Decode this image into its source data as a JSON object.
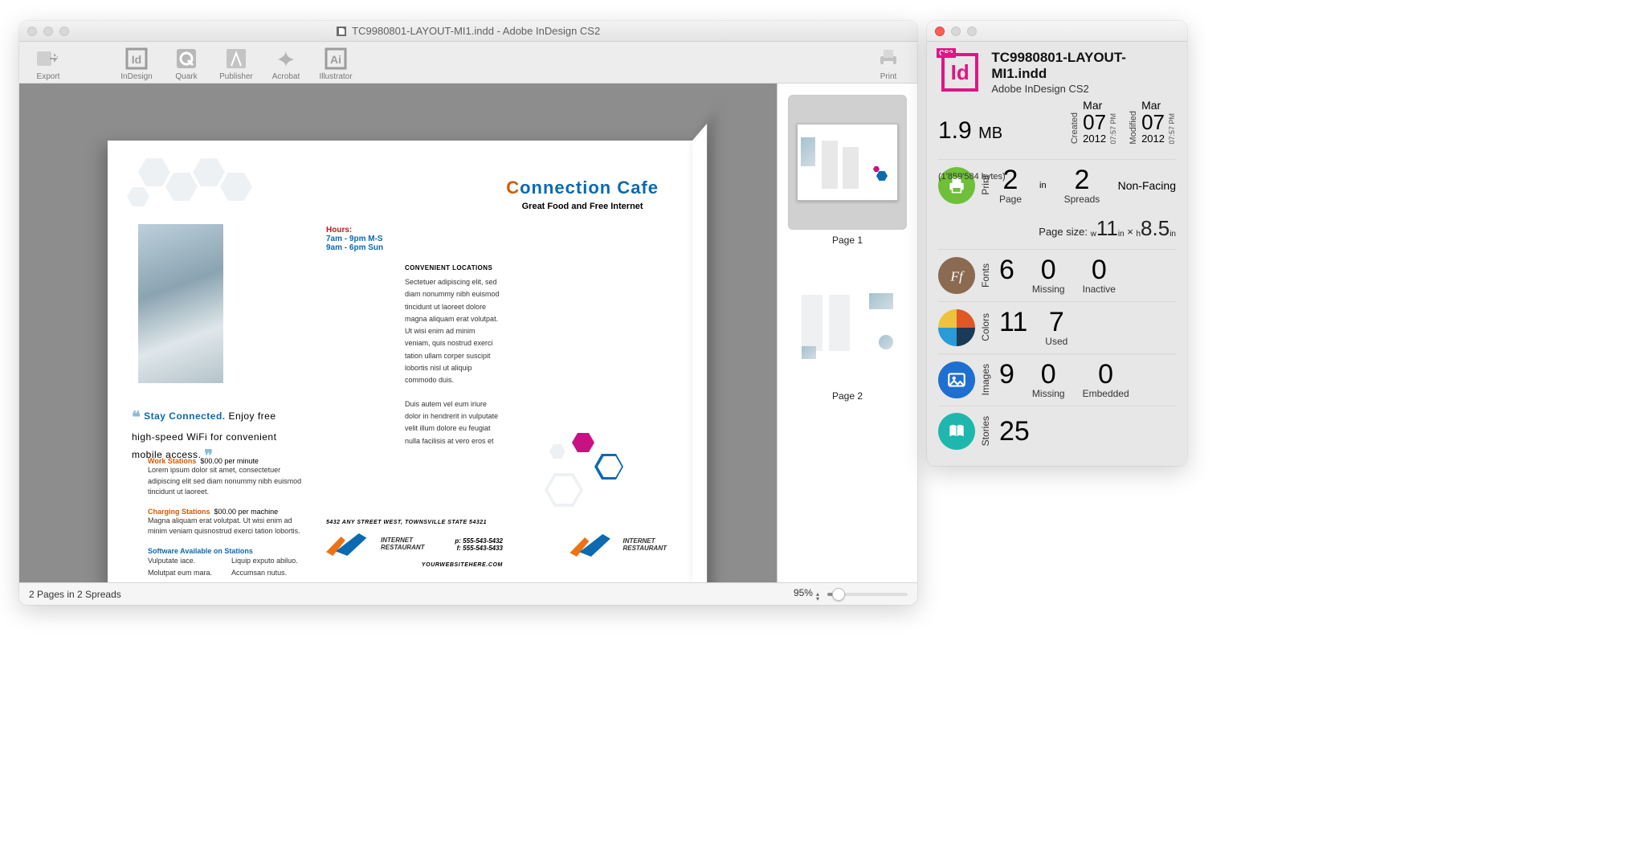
{
  "window": {
    "title": "TC9980801-LAYOUT-MI1.indd - Adobe InDesign CS2"
  },
  "toolbar": {
    "export": "Export",
    "indesign": "InDesign",
    "quark": "Quark",
    "publisher": "Publisher",
    "acrobat": "Acrobat",
    "illustrator": "Illustrator",
    "print": "Print"
  },
  "thumbs": {
    "page1": "Page 1",
    "page2": "Page 2"
  },
  "statusbar": {
    "pages": "2 Pages in 2 Spreads",
    "zoom": "95%"
  },
  "doc": {
    "brand_title_pre": "C",
    "brand_title_rest": "onnection Cafe",
    "brand_sub": "Great Food and Free Internet",
    "hours_label": "Hours:",
    "hours_line1": "7am - 9pm M-S",
    "hours_line2": "9am - 6pm Sun",
    "loc_head": "CONVENIENT LOCATIONS",
    "loc_body": "Sectetuer adipiscing elit, sed diam nonummy nibh euismod tincidunt ut laoreet dolore magna aliquam erat volutpat. Ut wisi enim ad minim veniam, quis nostrud exerci tation ullam corper suscipit lobortis nisl ut aliquip commodo duis.",
    "loc_body2": "Duis autem vel eum iriure dolor in hendrerit in vulputate velit illum dolore eu feugiat nulla facilisis at vero eros et",
    "stay_head": "Stay Connected.",
    "stay_rest": " Enjoy free high-speed WiFi for convenient mobile access. ",
    "work_label": "Work Stations",
    "work_price": "$00.00 per minute",
    "work_body": "Lorem ipsum dolor sit amet, consectetuer adipiscing elit sed diam nonummy nibh euismod tincidunt ut laoreet.",
    "charge_label": "Charging Stations",
    "charge_price": "$00.00 per machine",
    "charge_body": "Magna aliquam erat volutpat. Ut wisi enim ad minim veniam quisnostrud exerci tation lobortis.",
    "soft_label": "Software Available on Stations",
    "soft_c1a": "Vulputate iace.",
    "soft_c1b": "Molutpat eum mara.",
    "soft_c2a": "Liquip exputo abiluo.",
    "soft_c2b": "Accumsan nutus.",
    "addr": "5432 ANY STREET WEST, TOWNSVILLE STATE 54321",
    "phone": "p: 555-543-5432",
    "fax": "f: 555-543-5433",
    "site": "YOURWEBSITEHERE.COM",
    "logo_text_1": "INTERNET",
    "logo_text_2": "RESTAURANT"
  },
  "info": {
    "badge": "CS2",
    "filename": "TC9980801-LAYOUT-MI1.indd",
    "app": "Adobe InDesign CS2",
    "size_num": "1.9",
    "size_unit": "MB",
    "bytes": "(1'859'584 bytes)",
    "created_label": "Created",
    "created_month": "Mar",
    "created_day": "07",
    "created_year": "2012",
    "created_time": "07:57 PM",
    "modified_label": "Modified",
    "modified_month": "Mar",
    "modified_day": "07",
    "modified_year": "2012",
    "modified_time": "07:57 PM",
    "print_label": "Print",
    "pages_n": "2",
    "pages_l": "Page",
    "in": "in",
    "spreads_n": "2",
    "spreads_l": "Spreads",
    "facing": "Non-Facing",
    "pagesize_label": "Page size:",
    "ps_w": "11",
    "ps_h": "8.5",
    "ps_win": "in",
    "ps_hin": "in",
    "ps_x": "×",
    "ps_wpre": "w",
    "ps_hpre": "h",
    "fonts_label": "Fonts",
    "fonts_n": "6",
    "fonts_missing_n": "0",
    "fonts_missing_l": "Missing",
    "fonts_inactive_n": "0",
    "fonts_inactive_l": "Inactive",
    "colors_label": "Colors",
    "colors_n": "11",
    "colors_used_n": "7",
    "colors_used_l": "Used",
    "images_label": "Images",
    "images_n": "9",
    "images_missing_n": "0",
    "images_missing_l": "Missing",
    "images_embed_n": "0",
    "images_embed_l": "Embedded",
    "stories_label": "Stories",
    "stories_n": "25"
  }
}
